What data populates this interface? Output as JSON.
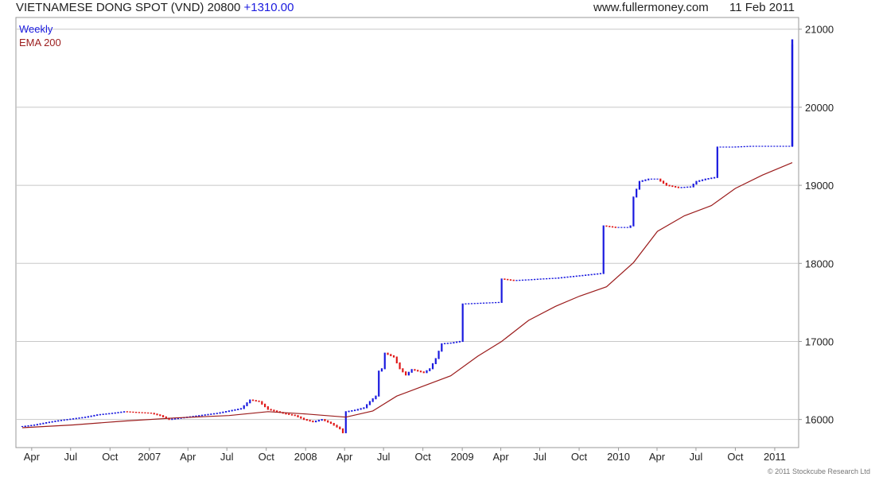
{
  "header": {
    "title": "VIETNAMESE DONG SPOT (VND) 20800",
    "change": "+1310.00",
    "site": "www.fullermoney.com",
    "date": "11 Feb 2011"
  },
  "legend": [
    {
      "label": "Weekly",
      "color": "#1a1adf"
    },
    {
      "label": "EMA 200",
      "color": "#9b1c1c"
    }
  ],
  "copyright": "© 2011 Stockcube Research Ltd",
  "chart_data": {
    "type": "line",
    "frequency": "weekly",
    "x_start": "2006-03-10",
    "y_ticks": [
      16000,
      17000,
      18000,
      19000,
      20000,
      21000
    ],
    "x_ticks": [
      "Apr",
      "Jul",
      "Oct",
      "2007",
      "Apr",
      "Jul",
      "Oct",
      "2008",
      "Apr",
      "Jul",
      "Oct",
      "2009",
      "Apr",
      "Jul",
      "Oct",
      "2010",
      "Apr",
      "Jul",
      "Oct",
      "2011"
    ],
    "x_tick_dates": [
      "2006-04-01",
      "2006-07-01",
      "2006-10-01",
      "2007-01-01",
      "2007-04-01",
      "2007-07-01",
      "2007-10-01",
      "2008-01-01",
      "2008-04-01",
      "2008-07-01",
      "2008-10-01",
      "2009-01-01",
      "2009-04-01",
      "2009-07-01",
      "2009-10-01",
      "2010-01-01",
      "2010-04-01",
      "2010-07-01",
      "2010-10-01",
      "2011-01-01"
    ],
    "ylim": [
      15640,
      21150
    ],
    "grid": true,
    "legend_position": "top-left",
    "up_color": "#1a1adf",
    "down_color": "#e01818",
    "ema_color": "#9b1c1c",
    "series": [
      {
        "name": "Weekly",
        "points": [
          [
            "2006-03-10",
            15910
          ],
          [
            "2006-04-07",
            15930
          ],
          [
            "2006-05-05",
            15960
          ],
          [
            "2006-06-02",
            15985
          ],
          [
            "2006-07-07",
            16010
          ],
          [
            "2006-08-04",
            16030
          ],
          [
            "2006-09-01",
            16060
          ],
          [
            "2006-10-06",
            16080
          ],
          [
            "2006-11-03",
            16100
          ],
          [
            "2006-12-01",
            16090
          ],
          [
            "2007-01-05",
            16080
          ],
          [
            "2007-01-26",
            16050
          ],
          [
            "2007-02-16",
            16000
          ],
          [
            "2007-03-16",
            16020
          ],
          [
            "2007-04-13",
            16040
          ],
          [
            "2007-05-11",
            16060
          ],
          [
            "2007-06-08",
            16080
          ],
          [
            "2007-07-06",
            16110
          ],
          [
            "2007-08-03",
            16140
          ],
          [
            "2007-08-24",
            16250
          ],
          [
            "2007-09-14",
            16230
          ],
          [
            "2007-10-05",
            16130
          ],
          [
            "2007-10-26",
            16100
          ],
          [
            "2007-11-16",
            16070
          ],
          [
            "2007-12-07",
            16050
          ],
          [
            "2007-12-28",
            16000
          ],
          [
            "2008-01-18",
            15970
          ],
          [
            "2008-02-08",
            16000
          ],
          [
            "2008-02-29",
            15950
          ],
          [
            "2008-03-21",
            15880
          ],
          [
            "2008-03-28",
            15830
          ],
          [
            "2008-04-04",
            16100
          ],
          [
            "2008-04-25",
            16120
          ],
          [
            "2008-05-16",
            16150
          ],
          [
            "2008-05-30",
            16230
          ],
          [
            "2008-06-13",
            16300
          ],
          [
            "2008-06-20",
            16620
          ],
          [
            "2008-06-27",
            16650
          ],
          [
            "2008-07-04",
            16850
          ],
          [
            "2008-07-25",
            16800
          ],
          [
            "2008-08-08",
            16650
          ],
          [
            "2008-08-22",
            16570
          ],
          [
            "2008-09-05",
            16640
          ],
          [
            "2008-09-19",
            16620
          ],
          [
            "2008-10-03",
            16600
          ],
          [
            "2008-10-17",
            16650
          ],
          [
            "2008-10-31",
            16780
          ],
          [
            "2008-11-14",
            16970
          ],
          [
            "2008-12-05",
            16980
          ],
          [
            "2008-12-26",
            17000
          ],
          [
            "2009-01-02",
            17480
          ],
          [
            "2009-02-13",
            17490
          ],
          [
            "2009-03-27",
            17500
          ],
          [
            "2009-04-03",
            17800
          ],
          [
            "2009-05-01",
            17780
          ],
          [
            "2009-06-05",
            17790
          ],
          [
            "2009-07-03",
            17800
          ],
          [
            "2009-08-07",
            17810
          ],
          [
            "2009-09-11",
            17830
          ],
          [
            "2009-10-16",
            17850
          ],
          [
            "2009-11-20",
            17870
          ],
          [
            "2009-11-27",
            18480
          ],
          [
            "2009-12-25",
            18460
          ],
          [
            "2010-01-22",
            18460
          ],
          [
            "2010-01-29",
            18480
          ],
          [
            "2010-02-05",
            18850
          ],
          [
            "2010-02-19",
            19050
          ],
          [
            "2010-03-12",
            19080
          ],
          [
            "2010-04-02",
            19080
          ],
          [
            "2010-04-23",
            19000
          ],
          [
            "2010-05-21",
            18970
          ],
          [
            "2010-06-18",
            18980
          ],
          [
            "2010-07-02",
            19050
          ],
          [
            "2010-07-23",
            19080
          ],
          [
            "2010-08-13",
            19100
          ],
          [
            "2010-08-20",
            19490
          ],
          [
            "2010-09-24",
            19490
          ],
          [
            "2010-11-05",
            19500
          ],
          [
            "2010-12-17",
            19500
          ],
          [
            "2011-02-04",
            19500
          ],
          [
            "2011-02-11",
            20800
          ]
        ]
      },
      {
        "name": "EMA 200",
        "points": [
          [
            "2006-03-10",
            15895
          ],
          [
            "2006-07-07",
            15930
          ],
          [
            "2006-11-03",
            15980
          ],
          [
            "2007-03-02",
            16020
          ],
          [
            "2007-07-06",
            16050
          ],
          [
            "2007-10-05",
            16100
          ],
          [
            "2008-01-04",
            16070
          ],
          [
            "2008-04-04",
            16030
          ],
          [
            "2008-06-06",
            16110
          ],
          [
            "2008-08-01",
            16300
          ],
          [
            "2008-10-03",
            16430
          ],
          [
            "2008-12-05",
            16560
          ],
          [
            "2009-02-06",
            16810
          ],
          [
            "2009-04-03",
            17000
          ],
          [
            "2009-06-05",
            17270
          ],
          [
            "2009-08-07",
            17450
          ],
          [
            "2009-10-02",
            17580
          ],
          [
            "2009-12-04",
            17700
          ],
          [
            "2010-02-05",
            18010
          ],
          [
            "2010-04-02",
            18410
          ],
          [
            "2010-06-04",
            18610
          ],
          [
            "2010-08-06",
            18740
          ],
          [
            "2010-10-01",
            18960
          ],
          [
            "2010-12-03",
            19130
          ],
          [
            "2011-02-11",
            19290
          ]
        ]
      }
    ]
  }
}
